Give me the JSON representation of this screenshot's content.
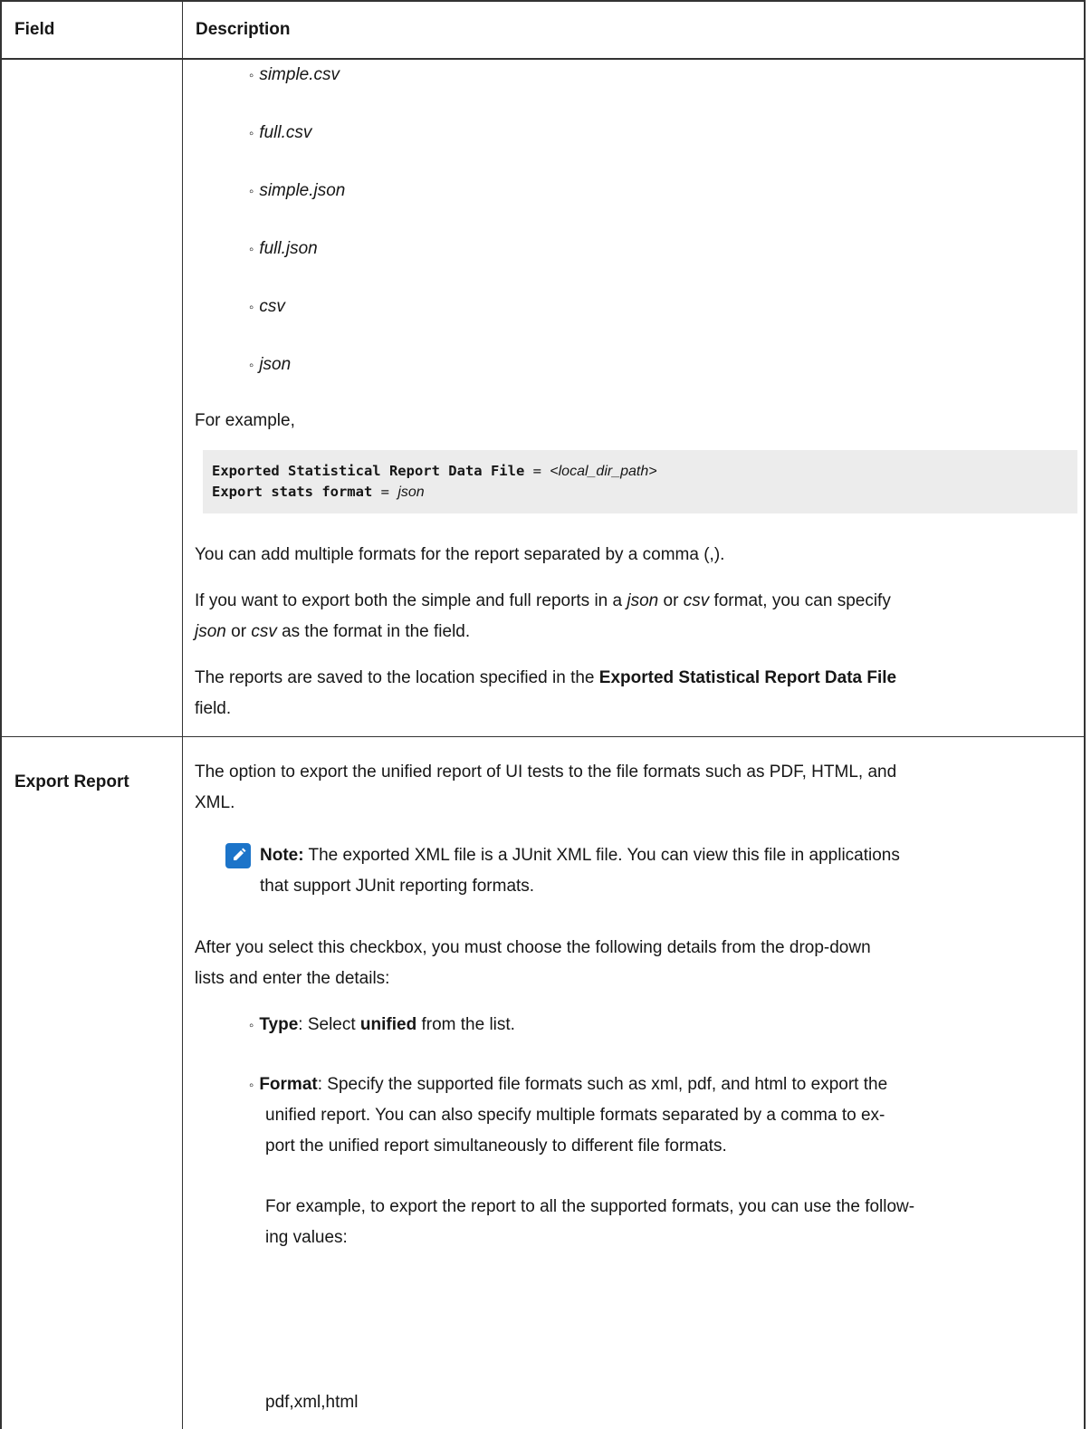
{
  "table": {
    "header_field": "Field",
    "header_description": "Description"
  },
  "row1": {
    "formats": [
      "simple.csv",
      "full.csv",
      "simple.json",
      "full.json",
      "csv",
      "json"
    ],
    "for_example": "For example,",
    "code_line1_key": "Exported Statistical Report Data File",
    "code_line1_eq": " = ",
    "code_line1_val": "<local_dir_path>",
    "code_line2_key": "Export stats format",
    "code_line2_eq": " = ",
    "code_line2_val": "json",
    "para_multiple": "You can add multiple formats for the report separated by a comma (,).",
    "para_both_1": "If you want to export both the simple and full reports in a ",
    "para_both_json": "json",
    "para_both_or": " or ",
    "para_both_csv": "csv",
    "para_both_2": " format, you can specify",
    "para_both_3json": "json",
    "para_both_3or": " or ",
    "para_both_3csv": "csv",
    "para_both_3": " as the format in the field.",
    "para_saved_1": "The reports are saved to the location specified in the ",
    "para_saved_bold": "Exported Statistical Report Data File",
    "para_saved_2": "field."
  },
  "row2": {
    "field": "Export Report",
    "desc_line1": "The option to export the unified report of UI tests to the file formats such as PDF, HTML, and",
    "desc_line2": "XML.",
    "note_label": "Note:",
    "note_line1": " The exported XML file is a JUnit XML file. You can view this file in applications",
    "note_line2": "that support JUnit reporting formats.",
    "after_line1": "After you select this checkbox, you must choose the following details from the drop-down",
    "after_line2": "lists and enter the details:",
    "type_label": "Type",
    "type_text1": ": Select ",
    "type_bold": "unified",
    "type_text2": " from the list.",
    "format_label": "Format",
    "format_line1": ": Specify the supported file formats such as xml, pdf, and html to export the",
    "format_line2": "unified report. You can also specify multiple formats separated by a comma to ex-",
    "format_line3": "port the unified report simultaneously to different file formats.",
    "example_line1": "For example, to export the report to all the supported formats, you can use the follow-",
    "example_line2": "ing values:",
    "example_value": "pdf,xml,html"
  },
  "colors": {
    "note_icon": "#1c74c9",
    "code_bg": "#ececec"
  }
}
